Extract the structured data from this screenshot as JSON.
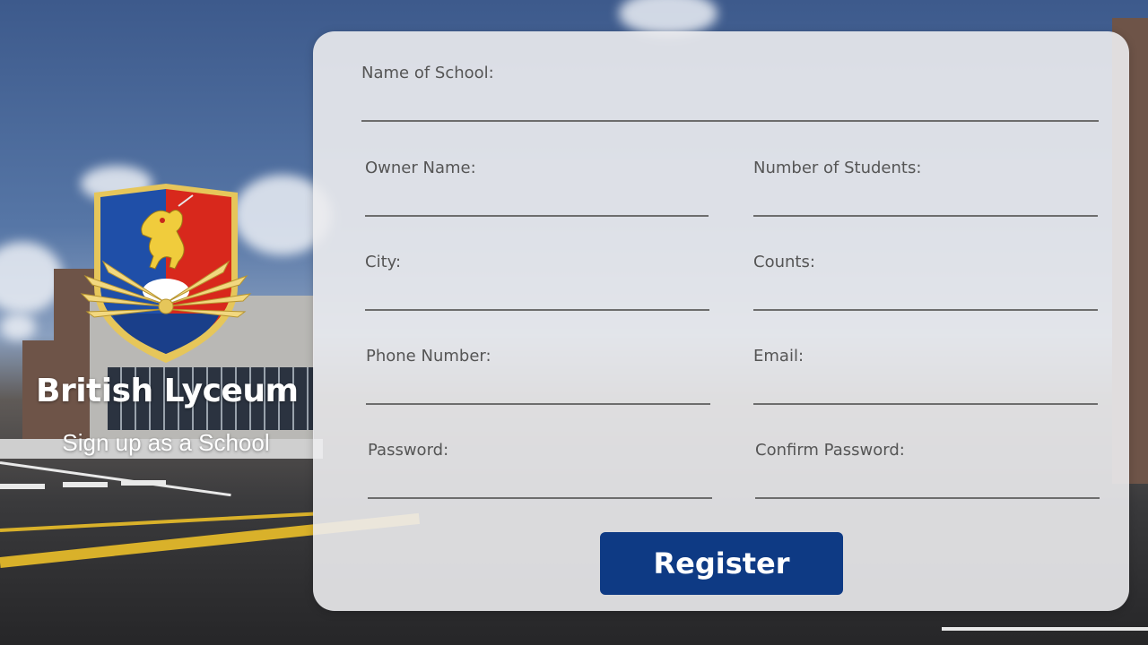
{
  "brand": {
    "name": "British Lyceum",
    "subtitle": "Sign up as a School"
  },
  "form": {
    "school_name": {
      "label": "Name of School:",
      "value": ""
    },
    "owner_name": {
      "label": "Owner Name:",
      "value": ""
    },
    "number_of_students": {
      "label": "Number of Students:",
      "value": ""
    },
    "city": {
      "label": "City:",
      "value": ""
    },
    "counts": {
      "label": "Counts:",
      "value": ""
    },
    "phone_number": {
      "label": "Phone Number:",
      "value": ""
    },
    "email": {
      "label": "Email:",
      "value": ""
    },
    "password": {
      "label": "Password:",
      "value": ""
    },
    "confirm_password": {
      "label": "Confirm Password:",
      "value": ""
    },
    "register_label": "Register"
  },
  "colors": {
    "button": "#0e3a84",
    "crest_blue": "#1f4fa8",
    "crest_red": "#d8281c",
    "crest_gold": "#e6c65a"
  },
  "icons": {
    "crest": "lion-shield-crest-icon"
  }
}
